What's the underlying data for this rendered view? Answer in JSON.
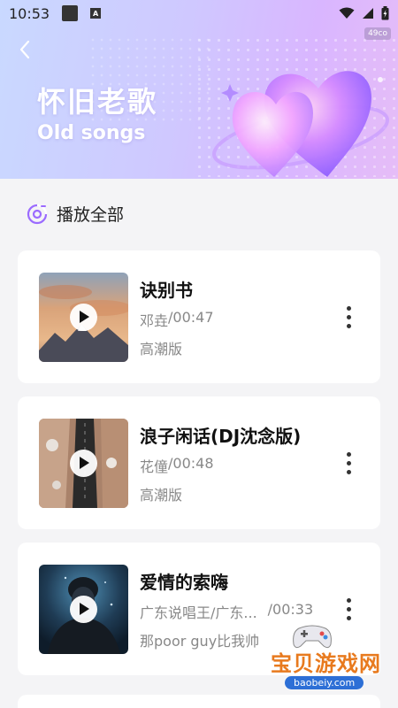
{
  "status_bar": {
    "time": "10:53",
    "chip": "49co"
  },
  "header": {
    "title_cn": "怀旧老歌",
    "title_en": "Old songs"
  },
  "play_all": {
    "label": "播放全部"
  },
  "songs": [
    {
      "title": "诀别书",
      "artist": "邓垚",
      "duration": "/00:47",
      "tag": "高潮版"
    },
    {
      "title": "浪子闲话(DJ沈念版)",
      "artist": "花僮",
      "duration": "/00:48",
      "tag": "高潮版"
    },
    {
      "title": "爱情的索嗨",
      "artist": "广东说唱王/广东...",
      "duration": "/00:33",
      "tag": "那poor guy比我帅"
    }
  ],
  "watermark": {
    "name": "宝贝游戏网",
    "url": "baobeiy.com"
  },
  "colors": {
    "accent": "#9b6bff",
    "banner_start": "#c9d9ff",
    "banner_end": "#e6bdf7"
  }
}
